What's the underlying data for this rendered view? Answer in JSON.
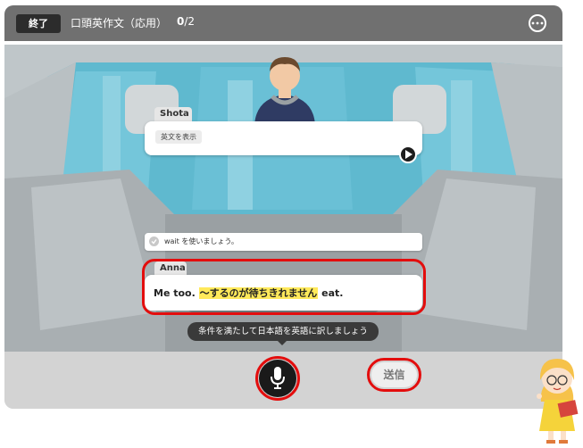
{
  "header": {
    "end_label": "終了",
    "title": "口頭英作文（応用）",
    "progress_current": "0",
    "progress_total": "/2"
  },
  "shota": {
    "name": "Shota",
    "show_english_label": "英文を表示"
  },
  "hint": {
    "text": "wait を使いましょう。"
  },
  "anna": {
    "name": "Anna",
    "prefix": "Me too. ",
    "highlight": "～するのが待ちきれません",
    "suffix": " eat."
  },
  "tooltip": {
    "text": "条件を満たして日本語を英語に訳しましょう"
  },
  "controls": {
    "send_label": "送信"
  },
  "colors": {
    "accent_ring": "#e30d0d",
    "highlight": "#ffe95a",
    "header_bg": "#707070"
  }
}
